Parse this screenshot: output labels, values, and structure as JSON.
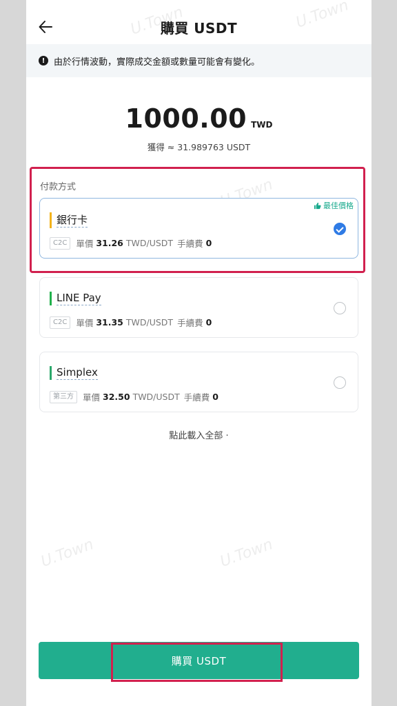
{
  "header": {
    "title": "購買 USDT",
    "back_icon": "arrow-left-icon"
  },
  "notice": {
    "text": "由於行情波動，實際成交金額或數量可能會有變化。",
    "icon": "exclamation-icon"
  },
  "order": {
    "amount": "1000.00",
    "currency": "TWD",
    "receive": "獲得 ≈ 31.989763 USDT"
  },
  "payment": {
    "label": "付款方式",
    "best_badge": "最佳價格",
    "methods": [
      {
        "name": "銀行卡",
        "tag": "C2C",
        "price_label": "單價",
        "price": "31.26",
        "unit": "TWD/USDT",
        "fee_label": "手續費",
        "fee": "0",
        "selected": true,
        "accent": "#f3b31b"
      },
      {
        "name": "LINE Pay",
        "tag": "C2C",
        "price_label": "單價",
        "price": "31.35",
        "unit": "TWD/USDT",
        "fee_label": "手續費",
        "fee": "0",
        "selected": false,
        "accent": "#21b14c"
      },
      {
        "name": "Simplex",
        "tag": "第三方",
        "price_label": "單價",
        "price": "32.50",
        "unit": "TWD/USDT",
        "fee_label": "手續費",
        "fee": "0",
        "selected": false,
        "accent": "#2ba86b"
      }
    ]
  },
  "load_all": "點此載入全部",
  "buy_button": "購買 USDT",
  "watermark": "U.Town",
  "colors": {
    "primary": "#21ae8e",
    "highlight": "#d1204e",
    "check": "#2f7be5"
  }
}
